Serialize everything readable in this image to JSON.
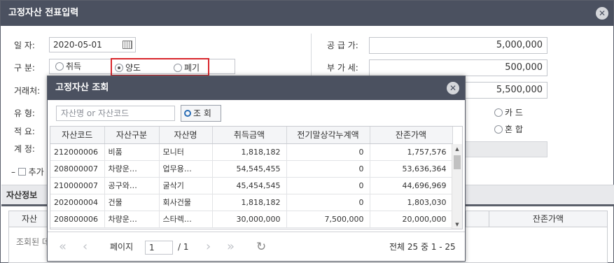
{
  "window": {
    "title": "고정자산 전표입력",
    "close": "✕"
  },
  "form": {
    "date_label": "일   자:",
    "date_value": "2020-05-01",
    "type_label": "구   분:",
    "type_options": [
      "취득",
      "양도",
      "폐기"
    ],
    "type_selected": "양도",
    "partner_label": "거래처:",
    "kind_label": "유   형:",
    "memo_label": "적   요:",
    "account_label": "계   정:",
    "add_label": "추가",
    "supply_label": "공  급  가:",
    "supply_value": "5,000,000",
    "vat_label": "부  가  세:",
    "vat_value": "500,000",
    "total_value": "5,500,000",
    "pay_options": [
      "카 드",
      "혼 합"
    ]
  },
  "section": {
    "title": "자산정보",
    "col_first": "자산",
    "col_last": "잔존가액",
    "empty_text": "조회된 데"
  },
  "modal": {
    "title": "고정자산 조회",
    "close": "✕",
    "search_placeholder": "자산명 or 자산코드",
    "search_button": "조 회",
    "columns": [
      "자산코드",
      "자산구분",
      "자산명",
      "취득금액",
      "전기말상각누계액",
      "잔존가액"
    ],
    "rows": [
      [
        "212000006",
        "비품",
        "모니터",
        "1,818,182",
        "0",
        "1,757,576"
      ],
      [
        "208000007",
        "차량운…",
        "업무용…",
        "54,545,455",
        "0",
        "53,636,364"
      ],
      [
        "210000007",
        "공구와…",
        "굴삭기",
        "45,454,545",
        "0",
        "44,696,969"
      ],
      [
        "202000004",
        "건물",
        "회사건물",
        "1,818,182",
        "0",
        "1,803,030"
      ],
      [
        "208000006",
        "차량운…",
        "스타렉…",
        "30,000,000",
        "7,500,000",
        "20,000,000"
      ]
    ],
    "pager": {
      "first": "«",
      "prev": "‹",
      "page_label": "페이지",
      "page_value": "1",
      "page_total": "/ 1",
      "next": "›",
      "last": "»",
      "refresh": "↻",
      "summary": "전체 25 중 1 - 25"
    }
  },
  "colors": {
    "title_bar": "#4b5160",
    "highlight": "#d9262c"
  }
}
